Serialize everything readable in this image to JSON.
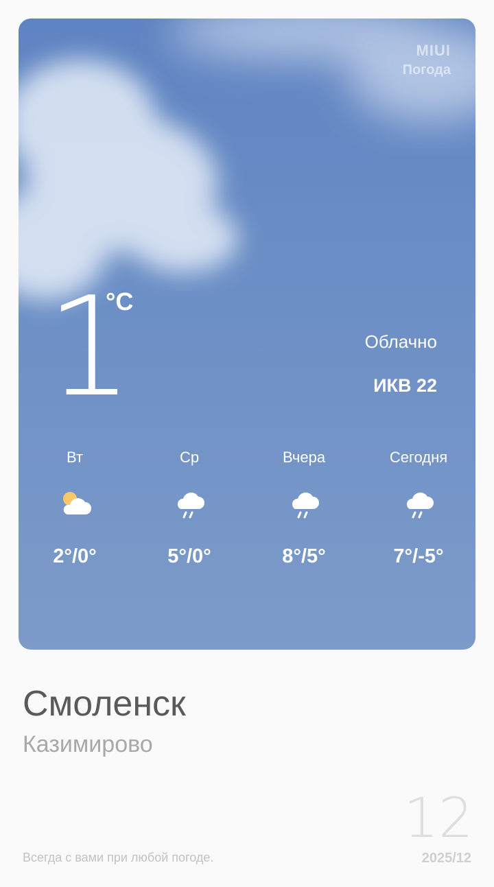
{
  "brand": {
    "line1": "MIUI",
    "line2": "Погода"
  },
  "current": {
    "temperature": "1",
    "unit": "°C",
    "condition": "Облачно",
    "aqi": "ИКВ 22"
  },
  "forecast": [
    {
      "label": "Вт",
      "range": "2°/0°",
      "icon": "partly-cloudy-icon"
    },
    {
      "label": "Ср",
      "range": "5°/0°",
      "icon": "rain-cloud-icon"
    },
    {
      "label": "Вчера",
      "range": "8°/5°",
      "icon": "rain-cloud-icon"
    },
    {
      "label": "Сегодня",
      "range": "7°/-5°",
      "icon": "rain-cloud-icon"
    }
  ],
  "location": {
    "city": "Смоленск",
    "district": "Казимирово"
  },
  "footer": {
    "slogan": "Всегда с вами при любой погоде.",
    "day": "12",
    "month": "2025/12"
  },
  "colors": {
    "sky": "#6c8fc6",
    "sun": "#f6c86a",
    "background": "#fafafa"
  }
}
